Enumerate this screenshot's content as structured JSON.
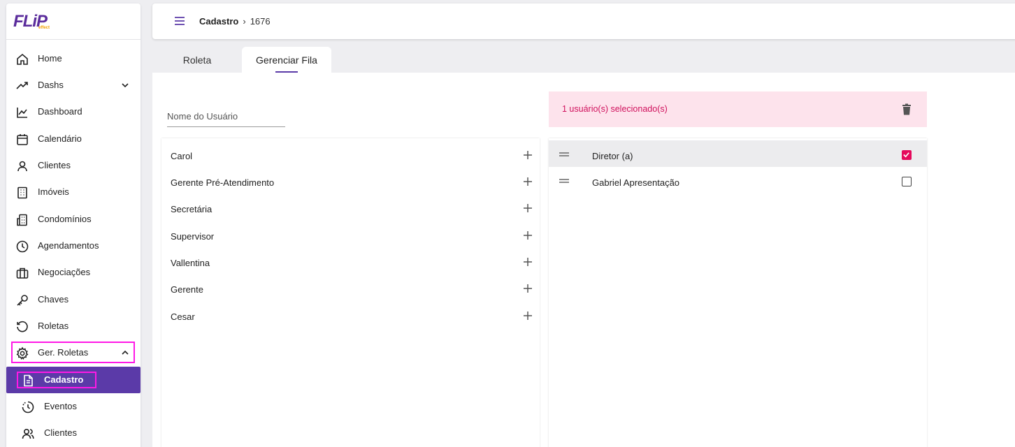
{
  "brand": {
    "logo": "FLiP",
    "logo_sub": "effect"
  },
  "sidebar": {
    "items": [
      {
        "label": "Home",
        "icon": "home-icon"
      },
      {
        "label": "Dashs",
        "icon": "trending-icon"
      },
      {
        "label": "Dashboard",
        "icon": "chart-line-icon"
      },
      {
        "label": "Calendário",
        "icon": "calendar-icon"
      },
      {
        "label": "Clientes",
        "icon": "user-icon"
      },
      {
        "label": "Imóveis",
        "icon": "building-icon"
      },
      {
        "label": "Condomínios",
        "icon": "condo-icon"
      },
      {
        "label": "Agendamentos",
        "icon": "clock-icon"
      },
      {
        "label": "Negociações",
        "icon": "briefcase-icon"
      },
      {
        "label": "Chaves",
        "icon": "key-icon"
      },
      {
        "label": "Roletas",
        "icon": "history-icon"
      },
      {
        "label": "Ger. Roletas",
        "icon": "gear-icon"
      }
    ],
    "sub_items": [
      {
        "label": "Cadastro",
        "icon": "document-icon"
      },
      {
        "label": "Eventos",
        "icon": "clock-history-icon"
      },
      {
        "label": "Clientes",
        "icon": "users-icon"
      }
    ]
  },
  "header": {
    "breadcrumb_root": "Cadastro",
    "breadcrumb_sep": "›",
    "breadcrumb_current": "1676"
  },
  "tabs": [
    {
      "label": "Roleta"
    },
    {
      "label": "Gerenciar Fila"
    }
  ],
  "search": {
    "placeholder": "Nome do Usuário"
  },
  "available_users": [
    "Carol",
    "Gerente Pré-Atendimento",
    "Secretária",
    "Supervisor",
    "Vallentina",
    "Gerente",
    "Cesar"
  ],
  "selection": {
    "message": "1 usuário(s) selecionado(s)"
  },
  "queue": [
    {
      "name": "Diretor (a)",
      "checked": true
    },
    {
      "name": "Gabriel Apresentação",
      "checked": false
    }
  ],
  "colors": {
    "accent": "#5b3aa8",
    "highlight": "#ff19e6",
    "alert_bg": "#fde3ec",
    "alert_text": "#d0105c",
    "checkbox_on": "#e5095c"
  }
}
